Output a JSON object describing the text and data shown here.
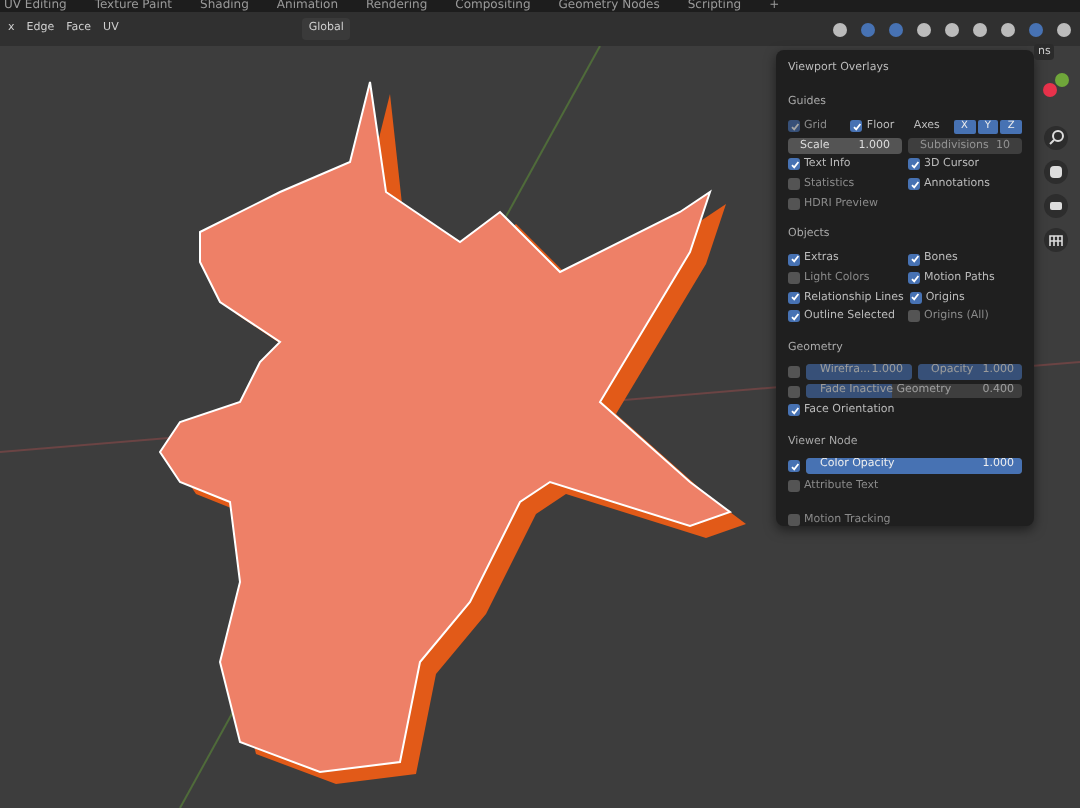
{
  "workspace_tabs": [
    "UV Editing",
    "Texture Paint",
    "Shading",
    "Animation",
    "Rendering",
    "Compositing",
    "Geometry Nodes",
    "Scripting",
    "+"
  ],
  "header": {
    "select_modes": [
      "x",
      "Edge",
      "Face",
      "UV"
    ],
    "orientation": "Global"
  },
  "sidebar_tab": "ns",
  "overlay_popup": {
    "title": "Viewport Overlays",
    "sections": [
      {
        "title": "Guides",
        "rows": [
          [
            {
              "kind": "check",
              "label": "Grid",
              "checked": true,
              "disabled": true
            },
            {
              "kind": "check",
              "label": "Floor",
              "checked": true,
              "disabled": false
            },
            {
              "kind": "label",
              "label": "Axes"
            },
            {
              "kind": "toggles",
              "items": [
                {
                  "label": "X",
                  "selected": true
                },
                {
                  "label": "Y",
                  "selected": true
                },
                {
                  "label": "Z",
                  "selected": true
                }
              ]
            }
          ],
          [
            {
              "kind": "number",
              "label": "Scale",
              "value": "1.000",
              "disabled": false
            },
            {
              "kind": "number",
              "label": "Subdivisions",
              "value": "10",
              "disabled": true
            }
          ],
          [
            {
              "kind": "check",
              "label": "Text Info",
              "checked": true,
              "disabled": false
            },
            {
              "kind": "check",
              "label": "3D Cursor",
              "checked": true,
              "disabled": false
            }
          ],
          [
            {
              "kind": "check",
              "label": "Statistics",
              "checked": false,
              "disabled": false
            },
            {
              "kind": "check",
              "label": "Annotations",
              "checked": true,
              "disabled": false
            }
          ],
          [
            {
              "kind": "check",
              "label": "HDRI Preview",
              "checked": false,
              "disabled": false
            }
          ]
        ]
      },
      {
        "title": "Objects",
        "rows": [
          [
            {
              "kind": "check",
              "label": "Extras",
              "checked": true,
              "disabled": false
            },
            {
              "kind": "check",
              "label": "Bones",
              "checked": true,
              "disabled": false
            }
          ],
          [
            {
              "kind": "check",
              "label": "Light Colors",
              "checked": false,
              "disabled": false
            },
            {
              "kind": "check",
              "label": "Motion Paths",
              "checked": true,
              "disabled": false
            }
          ],
          [
            {
              "kind": "check",
              "label": "Relationship Lines",
              "checked": true,
              "disabled": false
            },
            {
              "kind": "check",
              "label": "Origins",
              "checked": true,
              "disabled": false
            }
          ],
          [
            {
              "kind": "check",
              "label": "Outline Selected",
              "checked": true,
              "disabled": false
            },
            {
              "kind": "check",
              "label": "Origins (All)",
              "checked": false,
              "disabled": false
            }
          ]
        ]
      },
      {
        "title": "Geometry",
        "rows": [
          [
            {
              "kind": "check",
              "checked": false,
              "disabled": false
            },
            {
              "kind": "slider",
              "label": "Wirefra...",
              "value": "1.000",
              "level": 1,
              "disabled": true
            },
            {
              "kind": "slider",
              "label": "Opacity",
              "value": "1.000",
              "level": 1,
              "disabled": true
            }
          ],
          [
            {
              "kind": "check",
              "checked": false,
              "disabled": false
            },
            {
              "kind": "slider",
              "label": "Fade Inactive Geometry",
              "value": "0.400",
              "level": 0.4,
              "disabled": true
            }
          ],
          [
            {
              "kind": "check",
              "label": "Face Orientation",
              "checked": true,
              "disabled": false
            }
          ]
        ]
      },
      {
        "title": "Viewer Node",
        "rows": [
          [
            {
              "kind": "check",
              "checked": true,
              "disabled": false
            },
            {
              "kind": "slider",
              "label": "Color Opacity",
              "value": "1.000",
              "level": 1,
              "disabled": false
            }
          ],
          [
            {
              "kind": "check",
              "label": "Attribute Text",
              "checked": false,
              "disabled": false
            }
          ]
        ]
      },
      {
        "rows": [
          [
            {
              "kind": "check",
              "label": "Motion Tracking",
              "checked": false,
              "disabled": false
            }
          ]
        ]
      }
    ]
  }
}
